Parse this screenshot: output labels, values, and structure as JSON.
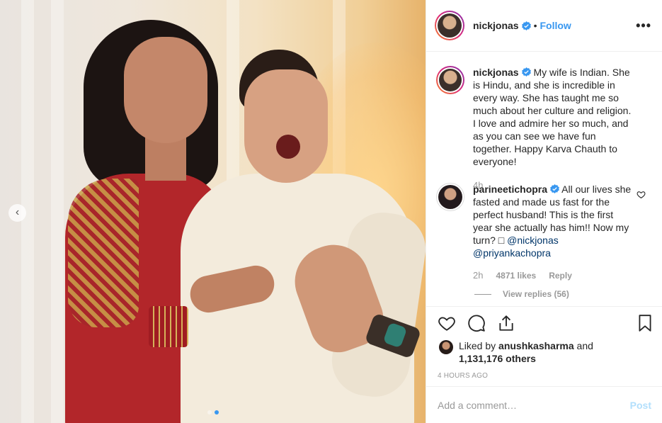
{
  "header": {
    "username": "nickjonas",
    "separator": "•",
    "follow_label": "Follow",
    "more_label": "•••"
  },
  "caption": {
    "username": "nickjonas",
    "text": "My wife is Indian. She is Hindu, and she is incredible in every way. She has taught me so much about her culture and religion. I love and admire her so much, and as you can see we have fun together. Happy Karva Chauth to everyone!",
    "time": "4h"
  },
  "comment": {
    "username": "parineetichopra",
    "text": "All our lives she fasted and made us fast for the perfect husband! This is the first year she actually has him!! Now my turn? □ ",
    "mention_1": "@nickjonas",
    "mention_2": "@priyankachopra",
    "time": "2h",
    "likes": "4871 likes",
    "reply_label": "Reply"
  },
  "view_replies": "View replies (56)",
  "liked_by": {
    "prefix": "Liked by",
    "user": "anushkasharma",
    "and": "and",
    "others": "1,131,176 others"
  },
  "timestamp": "4 HOURS AGO",
  "add_comment": {
    "placeholder": "Add a comment…",
    "post_label": "Post"
  },
  "carousel": {
    "prev_label": "‹",
    "slide_count": 2,
    "active_slide": 2
  },
  "icons": {
    "verified": "verified-badge-icon",
    "heart": "heart-icon",
    "comment": "comment-icon",
    "share": "share-icon",
    "bookmark": "bookmark-icon"
  },
  "colors": {
    "link": "#3897f0",
    "verified": "#3897f0",
    "muted": "#999999",
    "post_disabled": "#b2dffc"
  }
}
